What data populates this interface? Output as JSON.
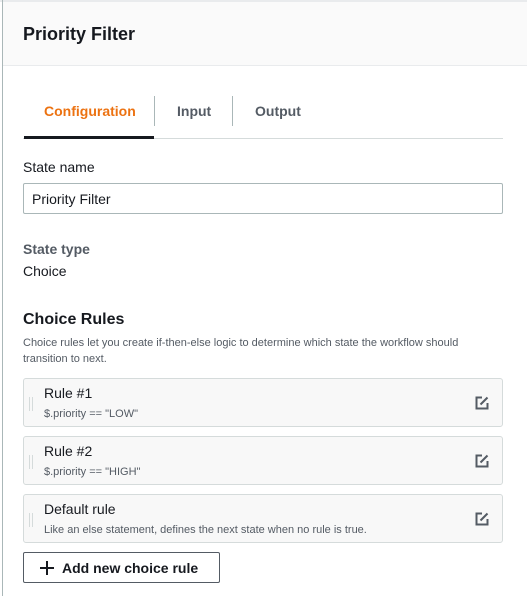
{
  "header": {
    "title": "Priority Filter"
  },
  "tabs": [
    {
      "label": "Configuration",
      "active": true
    },
    {
      "label": "Input"
    },
    {
      "label": "Output"
    }
  ],
  "state_name": {
    "label": "State name",
    "value": "Priority Filter"
  },
  "state_type": {
    "label": "State type",
    "value": "Choice"
  },
  "choice_rules": {
    "title": "Choice Rules",
    "description": "Choice rules let you create if-then-else logic to determine which state the workflow should transition to next.",
    "rules": [
      {
        "title": "Rule #1",
        "condition": "$.priority == \"LOW\"",
        "icon": "edit-icon"
      },
      {
        "title": "Rule #2",
        "condition": "$.priority == \"HIGH\"",
        "icon": "edit-icon"
      },
      {
        "title": "Default rule",
        "condition": "Like an else statement, defines the next state when no rule is true.",
        "icon": "edit-icon"
      }
    ],
    "add_button": "Add new choice rule"
  },
  "colors": {
    "accent": "#ec7211",
    "text": "#16191f",
    "muted": "#545b64"
  }
}
